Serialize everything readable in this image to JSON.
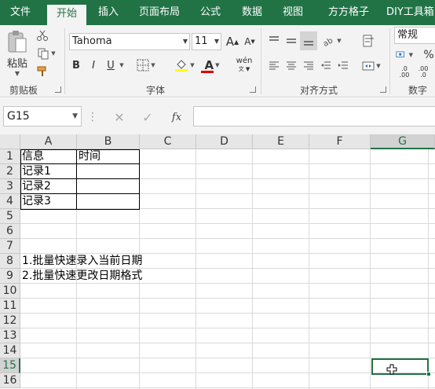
{
  "tabs": [
    "文件",
    "开始",
    "插入",
    "页面布局",
    "公式",
    "数据",
    "视图",
    "方方格子",
    "DIY工具箱"
  ],
  "ribbon": {
    "clipboard": {
      "paste_label": "粘贴",
      "group_label": "剪贴板"
    },
    "font": {
      "name": "Tahoma",
      "size": "11",
      "bold": "B",
      "italic": "I",
      "underline": "U",
      "grow": "A",
      "shrink": "A",
      "color_letter": "A",
      "phonetic": "wén",
      "group_label": "字体"
    },
    "alignment": {
      "group_label": "对齐方式"
    },
    "number": {
      "format": "常规",
      "percent": "%",
      "group_label": "数字",
      "dec_inc": ".0 .00",
      "dec_dec": ".00 .0"
    }
  },
  "formula_bar": {
    "name_box": "G15",
    "fx": "fx",
    "value": ""
  },
  "grid": {
    "columns": [
      "A",
      "B",
      "C",
      "D",
      "E",
      "F",
      "G"
    ],
    "rows": [
      "1",
      "2",
      "3",
      "4",
      "5",
      "6",
      "7",
      "8",
      "9",
      "10",
      "11",
      "12",
      "13",
      "14",
      "15",
      "16"
    ],
    "selected_column": "G",
    "selected_row": "15",
    "cells": {
      "A1": "信息",
      "B1": "时间",
      "A2": "记录1",
      "A3": "记录2",
      "A4": "记录3",
      "A8": "1.批量快速录入当前日期",
      "A9": "2.批量快速更改日期格式"
    }
  },
  "colors": {
    "accent": "#217346",
    "ribbon_bg": "#f3f3f3",
    "header_bg": "#e6e6e6"
  }
}
